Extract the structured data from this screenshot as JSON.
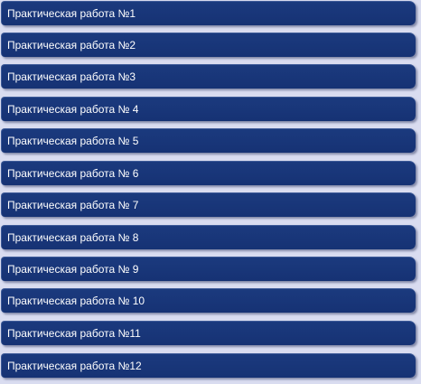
{
  "menu": {
    "items": [
      {
        "label": "Практическая работа №1"
      },
      {
        "label": "Практическая работа №2"
      },
      {
        "label": "Практическая работа №3"
      },
      {
        "label": "Практическая работа № 4"
      },
      {
        "label": "Практическая работа № 5"
      },
      {
        "label": "Практическая работа № 6"
      },
      {
        "label": "Практическая работа № 7"
      },
      {
        "label": "Практическая работа № 8"
      },
      {
        "label": "Практическая работа № 9"
      },
      {
        "label": "Практическая работа № 10"
      },
      {
        "label": "Практическая работа №11"
      },
      {
        "label": "Практическая работа №12"
      }
    ]
  }
}
